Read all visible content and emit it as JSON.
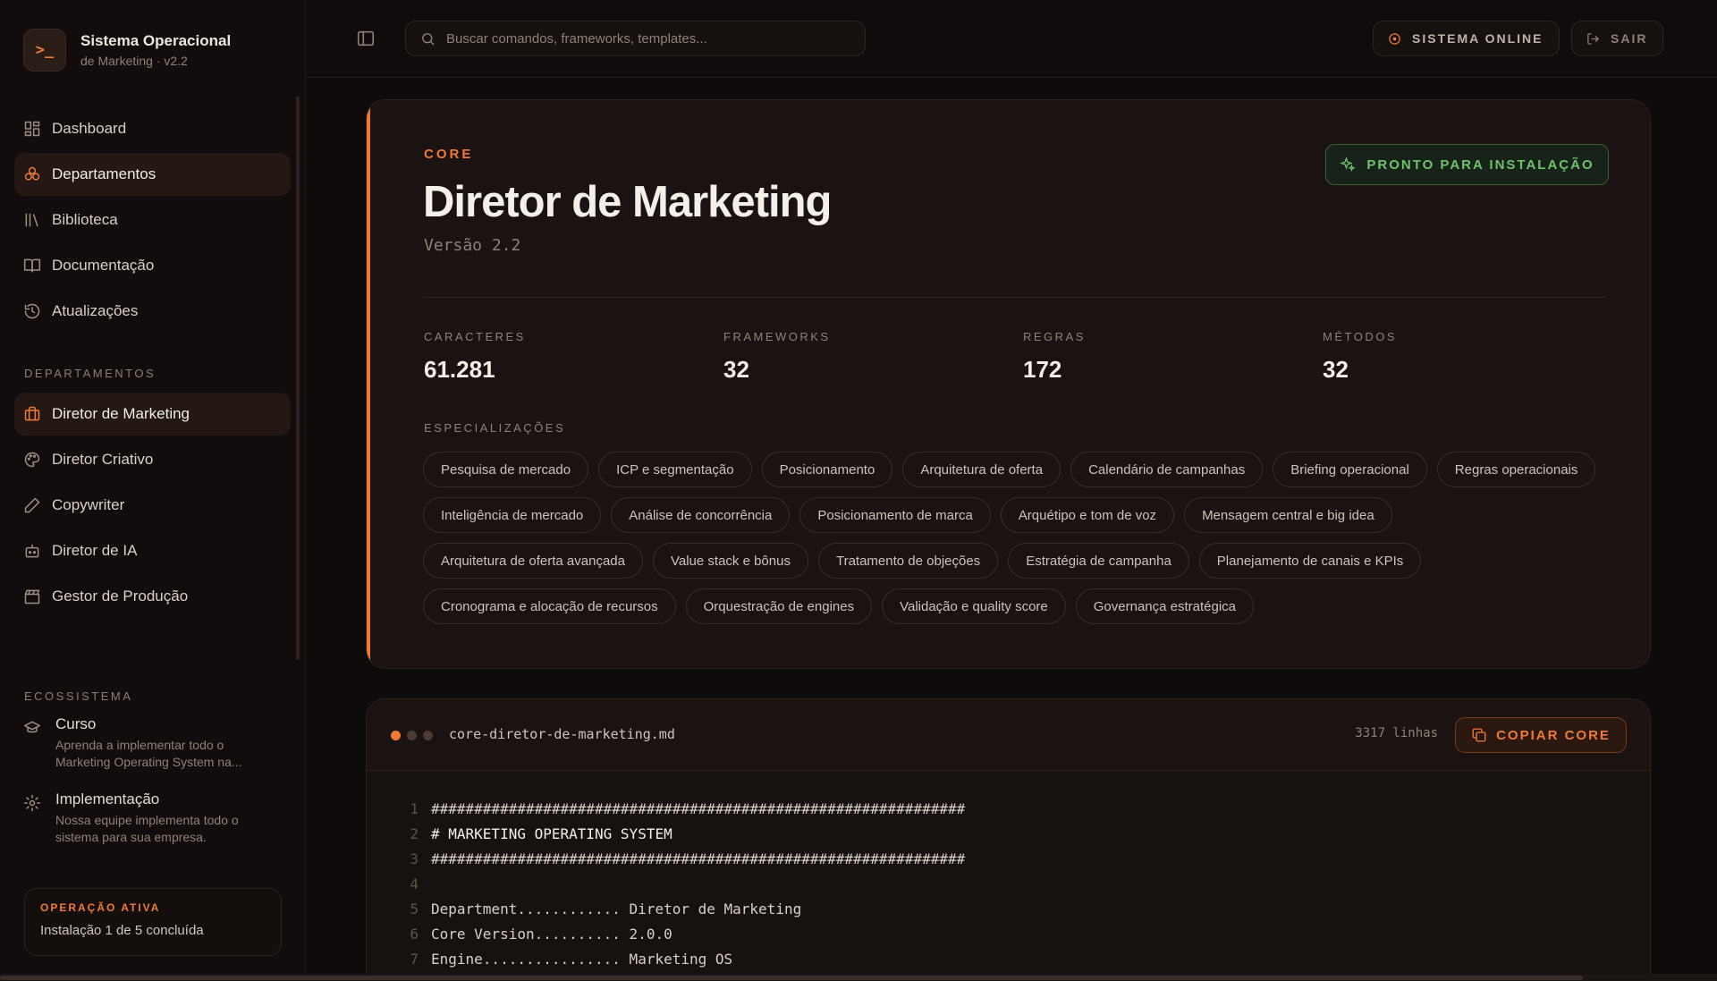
{
  "brand": {
    "title": "Sistema Operacional",
    "subtitle": "de Marketing · v2.2",
    "logo_glyph": ">_"
  },
  "nav": [
    {
      "label": "Dashboard",
      "icon": "dashboard-icon",
      "active": false
    },
    {
      "label": "Departamentos",
      "icon": "departments-icon",
      "active": true
    },
    {
      "label": "Biblioteca",
      "icon": "library-icon",
      "active": false
    },
    {
      "label": "Documentação",
      "icon": "book-icon",
      "active": false
    },
    {
      "label": "Atualizações",
      "icon": "history-icon",
      "active": false
    }
  ],
  "departments": {
    "label": "DEPARTAMENTOS",
    "items": [
      {
        "label": "Diretor de Marketing",
        "icon": "briefcase-icon",
        "active": true
      },
      {
        "label": "Diretor Criativo",
        "icon": "palette-icon",
        "active": false
      },
      {
        "label": "Copywriter",
        "icon": "pen-icon",
        "active": false
      },
      {
        "label": "Diretor de IA",
        "icon": "bot-icon",
        "active": false
      },
      {
        "label": "Gestor de Produção",
        "icon": "clapper-icon",
        "active": false
      }
    ]
  },
  "ecosystem": {
    "label": "ECOSSISTEMA",
    "items": [
      {
        "title": "Curso",
        "desc": "Aprenda a implementar todo o Marketing Operating System na...",
        "icon": "graduation-cap-icon"
      },
      {
        "title": "Implementação",
        "desc": "Nossa equipe implementa todo o sistema para sua empresa.",
        "icon": "gear-icon"
      }
    ]
  },
  "operation": {
    "label": "OPERAÇÃO ATIVA",
    "text": "Instalação 1 de 5 concluída"
  },
  "topbar": {
    "search_placeholder": "Buscar comandos, frameworks, templates...",
    "online_label": "SISTEMA ONLINE",
    "exit_label": "SAIR"
  },
  "card": {
    "tag": "CORE",
    "title": "Diretor de Marketing",
    "version": "Versão 2.2",
    "badge": "PRONTO PARA INSTALAÇÃO",
    "stats": [
      {
        "label": "CARACTERES",
        "value": "61.281"
      },
      {
        "label": "FRAMEWORKS",
        "value": "32"
      },
      {
        "label": "REGRAS",
        "value": "172"
      },
      {
        "label": "MÉTODOS",
        "value": "32"
      }
    ],
    "specializations_label": "ESPECIALIZAÇÕES",
    "specializations": [
      "Pesquisa de mercado",
      "ICP e segmentação",
      "Posicionamento",
      "Arquitetura de oferta",
      "Calendário de campanhas",
      "Briefing operacional",
      "Regras operacionais",
      "Inteligência de mercado",
      "Análise de concorrência",
      "Posicionamento de marca",
      "Arquétipo e tom de voz",
      "Mensagem central e big idea",
      "Arquitetura de oferta avançada",
      "Value stack e bônus",
      "Tratamento de objeções",
      "Estratégia de campanha",
      "Planejamento de canais e KPIs",
      "Cronograma e alocação de recursos",
      "Orquestração de engines",
      "Validação e quality score",
      "Governança estratégica"
    ]
  },
  "code": {
    "file_name": "core-diretor-de-marketing.md",
    "line_count": "3317 linhas",
    "copy_label": "COPIAR CORE",
    "lines": [
      {
        "n": "1",
        "text": "##############################################################"
      },
      {
        "n": "2",
        "text": "# MARKETING OPERATING SYSTEM"
      },
      {
        "n": "3",
        "text": "##############################################################"
      },
      {
        "n": "4",
        "text": ""
      },
      {
        "n": "5",
        "text": "Department............ Diretor de Marketing"
      },
      {
        "n": "6",
        "text": "Core Version.......... 2.0.0"
      },
      {
        "n": "7",
        "text": "Engine................ Marketing OS"
      }
    ]
  },
  "colors": {
    "accent": "#f07a35",
    "success": "#6fc26c",
    "background": "#0f0b0a"
  }
}
